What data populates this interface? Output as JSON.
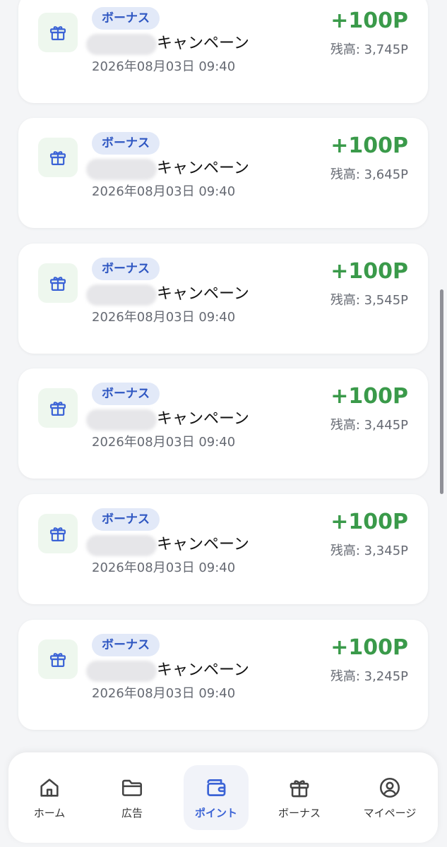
{
  "colors": {
    "accent": "#3b63d6",
    "amount": "#3a9a4a",
    "badge_bg": "#e2e9f8",
    "badge_text": "#2f57c2"
  },
  "transactions": [
    {
      "badge": "ボーナス",
      "title": "キャンペーン",
      "date": "2026年08月03日 09:40",
      "amount": "+100P",
      "balance": "残高: 3,745P",
      "icon": "gift-icon"
    },
    {
      "badge": "ボーナス",
      "title": "キャンペーン",
      "date": "2026年08月03日 09:40",
      "amount": "+100P",
      "balance": "残高: 3,645P",
      "icon": "gift-icon"
    },
    {
      "badge": "ボーナス",
      "title": "キャンペーン",
      "date": "2026年08月03日 09:40",
      "amount": "+100P",
      "balance": "残高: 3,545P",
      "icon": "gift-icon"
    },
    {
      "badge": "ボーナス",
      "title": "キャンペーン",
      "date": "2026年08月03日 09:40",
      "amount": "+100P",
      "balance": "残高: 3,445P",
      "icon": "gift-icon"
    },
    {
      "badge": "ボーナス",
      "title": "キャンペーン",
      "date": "2026年08月03日 09:40",
      "amount": "+100P",
      "balance": "残高: 3,345P",
      "icon": "gift-icon"
    },
    {
      "badge": "ボーナス",
      "title": "キャンペーン",
      "date": "2026年08月03日 09:40",
      "amount": "+100P",
      "balance": "残高: 3,245P",
      "icon": "gift-icon"
    }
  ],
  "nav": {
    "items": [
      {
        "label": "ホーム",
        "icon": "home-icon"
      },
      {
        "label": "広告",
        "icon": "folder-icon"
      },
      {
        "label": "ポイント",
        "icon": "wallet-icon",
        "active": true
      },
      {
        "label": "ボーナス",
        "icon": "gift-icon"
      },
      {
        "label": "マイページ",
        "icon": "user-icon"
      }
    ]
  }
}
